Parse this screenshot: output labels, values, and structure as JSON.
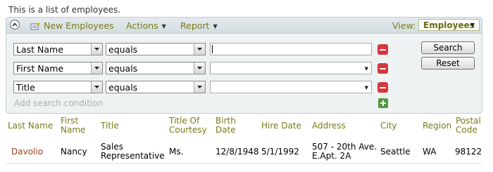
{
  "intro_text": "This is a list of employees.",
  "toolbar": {
    "new_label": "New Employees",
    "actions_label": "Actions",
    "report_label": "Report",
    "view_label": "View:",
    "view_value": "Employees"
  },
  "search": {
    "rows": [
      {
        "field": "Last Name",
        "operator": "equals",
        "value": ""
      },
      {
        "field": "First Name",
        "operator": "equals",
        "value": ""
      },
      {
        "field": "Title",
        "operator": "equals",
        "value": ""
      }
    ],
    "add_condition_label": "Add search condition",
    "search_button": "Search",
    "reset_button": "Reset"
  },
  "grid": {
    "columns": [
      {
        "l1": "Last Name",
        "l2": ""
      },
      {
        "l1": "First",
        "l2": "Name"
      },
      {
        "l1": "Title",
        "l2": ""
      },
      {
        "l1": "Title Of",
        "l2": "Courtesy"
      },
      {
        "l1": "Birth",
        "l2": "Date"
      },
      {
        "l1": "Hire Date",
        "l2": ""
      },
      {
        "l1": "Address",
        "l2": ""
      },
      {
        "l1": "City",
        "l2": ""
      },
      {
        "l1": "Region",
        "l2": ""
      },
      {
        "l1": "Postal",
        "l2": "Code"
      }
    ],
    "rows": [
      {
        "last_name": "Davolio",
        "first_name": "Nancy",
        "title_l1": "Sales",
        "title_l2": "Representative",
        "courtesy": "Ms.",
        "birth_date": "12/8/1948",
        "hire_date": "5/1/1992",
        "address_l1": "507 - 20th Ave.",
        "address_l2": "E.Apt. 2A",
        "city": "Seattle",
        "region": "WA",
        "postal_code": "98122"
      }
    ]
  },
  "colors": {
    "accent": "#7a7a18",
    "link": "#a0401c",
    "remove": "#d4373f",
    "add": "#4f9a3e"
  },
  "icons": [
    "collapse-icon",
    "new-record-icon",
    "remove-icon",
    "add-icon",
    "dropdown-arrow-icon"
  ]
}
